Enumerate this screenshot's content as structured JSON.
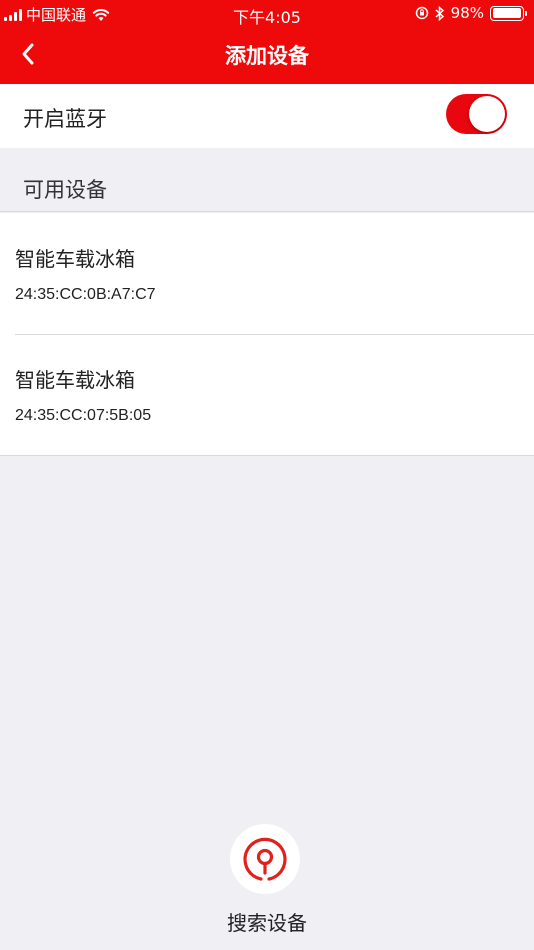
{
  "status_bar": {
    "carrier": "中国联通",
    "time": "下午4:05",
    "battery_percent": "98%",
    "battery_level": 0.98,
    "icons": [
      "signal-icon",
      "wifi-icon",
      "orientation-lock-icon",
      "bluetooth-icon",
      "battery-icon"
    ]
  },
  "nav": {
    "title": "添加设备",
    "back_icon": "chevron-left-icon"
  },
  "bluetooth": {
    "label": "开启蓝牙",
    "enabled": true
  },
  "section": {
    "title": "可用设备"
  },
  "devices": [
    {
      "name": "智能车载冰箱",
      "mac": "24:35:CC:0B:A7:C7"
    },
    {
      "name": "智能车载冰箱",
      "mac": "24:35:CC:07:5B:05"
    }
  ],
  "search": {
    "label": "搜索设备",
    "icon": "search-pin-icon"
  },
  "colors": {
    "brand_red": "#ee0a0a",
    "toggle_red": "#e8060f",
    "background": "#efeff4"
  }
}
